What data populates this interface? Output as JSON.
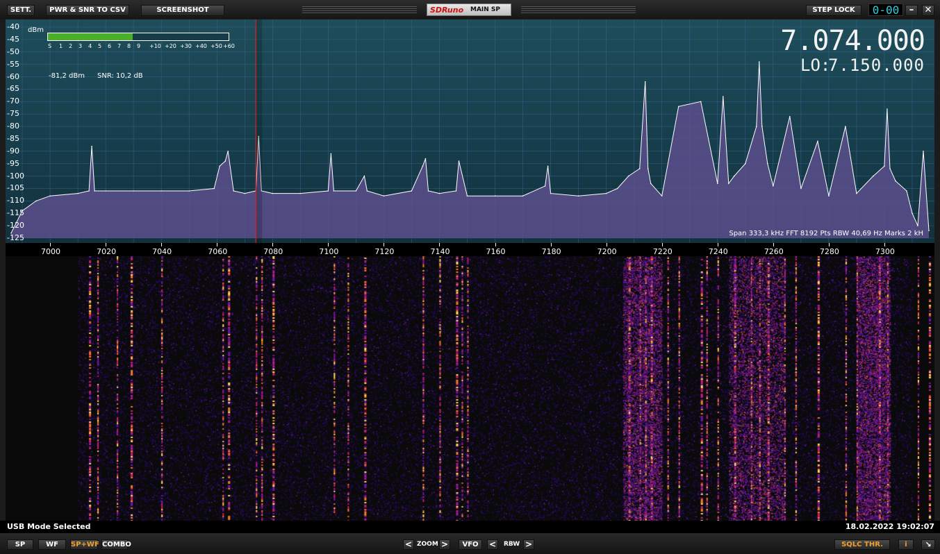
{
  "toolbar": {
    "settings_label": "SETT.",
    "csv_label": "PWR & SNR TO CSV",
    "screenshot_label": "SCREENSHOT",
    "logo_text": "SDRuno",
    "panel_title": "MAIN SP",
    "step_lock_label": "STEP LOCK",
    "step_display": "0-00",
    "minimize_icon": "minimize-icon",
    "close_icon": "close-icon"
  },
  "spectrum": {
    "dbm_unit": "dBm",
    "y_labels": [
      "-40",
      "-45",
      "-50",
      "-55",
      "-60",
      "-65",
      "-70",
      "-75",
      "-80",
      "-85",
      "-90",
      "-95",
      "-100",
      "-105",
      "-110",
      "-115",
      "-120",
      "-125"
    ],
    "x_labels": [
      "7000",
      "7020",
      "7040",
      "7060",
      "7080",
      "7100",
      "7120",
      "7140",
      "7160",
      "7180",
      "7200",
      "7220",
      "7240",
      "7260",
      "7280",
      "7300"
    ],
    "s_scale": [
      "S",
      "1",
      "2",
      "3",
      "4",
      "5",
      "6",
      "7",
      "8",
      "9",
      "+10",
      "+20",
      "+30",
      "+40",
      "+50",
      "+60"
    ],
    "meter_level_fraction": 0.47,
    "signal_level": "-81,2 dBm",
    "snr": "SNR: 10,2 dB",
    "vfo_frequency": "7.074.000",
    "lo_label": "LO:",
    "lo_frequency": "7.150.000",
    "info_line": "Span 333,3 kHz   FFT 8192 Pts   RBW 40,69 Hz   Marks 2 kH",
    "colors": {
      "background": "#1f4d5a",
      "trace_fill": "#5a4f8c",
      "trace_line": "#ffffff",
      "vfo_marker": "#e02020",
      "meter": "#4caf2a"
    }
  },
  "chart_data": {
    "type": "area",
    "title": "",
    "xlabel": "",
    "ylabel": "dBm",
    "xlim": [
      6984,
      7318
    ],
    "ylim": [
      -125,
      -40
    ],
    "grid": true,
    "x": [
      6986,
      6990,
      6995,
      7000,
      7010,
      7014,
      7015,
      7016,
      7020,
      7030,
      7040,
      7050,
      7059,
      7061,
      7063,
      7064,
      7066,
      7070,
      7074,
      7075,
      7076,
      7080,
      7090,
      7100,
      7101,
      7102,
      7110,
      7113,
      7114,
      7120,
      7130,
      7134,
      7135,
      7136,
      7140,
      7146,
      7147,
      7150,
      7160,
      7170,
      7178,
      7179,
      7180,
      7190,
      7200,
      7204,
      7208,
      7212,
      7214,
      7215,
      7216,
      7220,
      7226,
      7234,
      7240,
      7242,
      7244,
      7246,
      7250,
      7254,
      7255,
      7256,
      7258,
      7260,
      7266,
      7270,
      7276,
      7280,
      7286,
      7290,
      7296,
      7300,
      7301,
      7302,
      7304,
      7308,
      7310,
      7312,
      7314,
      7316
    ],
    "y": [
      -123,
      -114,
      -110,
      -108,
      -107,
      -106,
      -88,
      -106,
      -106,
      -106,
      -106,
      -106,
      -105,
      -96,
      -94,
      -90,
      -106,
      -107,
      -106,
      -84,
      -106,
      -107,
      -107,
      -106,
      -91,
      -106,
      -106,
      -100,
      -106,
      -108,
      -106,
      -96,
      -93,
      -106,
      -107,
      -106,
      -94,
      -108,
      -108,
      -108,
      -104,
      -96,
      -107,
      -108,
      -107,
      -105,
      -100,
      -97,
      -62,
      -97,
      -103,
      -108,
      -72,
      -70,
      -103,
      -68,
      -103,
      -100,
      -95,
      -80,
      -54,
      -80,
      -95,
      -104,
      -76,
      -105,
      -86,
      -108,
      -80,
      -107,
      -100,
      -96,
      -73,
      -97,
      -102,
      -106,
      -115,
      -120,
      -90,
      -122
    ],
    "series": [
      {
        "values": [
          -123,
          -114,
          -110,
          -108,
          -107,
          -106,
          -88,
          -106,
          -106,
          -106,
          -106,
          -106,
          -105,
          -96,
          -94,
          -90,
          -106,
          -107,
          -106,
          -84,
          -106,
          -107,
          -107,
          -106,
          -91,
          -106,
          -106,
          -100,
          -106,
          -108,
          -106,
          -96,
          -93,
          -106,
          -107,
          -106,
          -94,
          -108,
          -108,
          -108,
          -104,
          -96,
          -107,
          -108,
          -107,
          -105,
          -100,
          -97,
          -62,
          -97,
          -103,
          -108,
          -72,
          -70,
          -103,
          -68,
          -103,
          -100,
          -95,
          -80,
          -54,
          -80,
          -95,
          -104,
          -76,
          -105,
          -86,
          -108,
          -80,
          -107,
          -100,
          -96,
          -73,
          -97,
          -102,
          -106,
          -115,
          -120,
          -90,
          -122
        ]
      }
    ],
    "vfo_marker_khz": 7074
  },
  "waterfall": {
    "bright_lines_khz": [
      7014,
      7017,
      7024,
      7029,
      7040,
      7062,
      7064,
      7074,
      7076,
      7080,
      7102,
      7107,
      7113,
      7134,
      7140,
      7146,
      7148,
      7150,
      7208,
      7212,
      7214,
      7216,
      7222,
      7226,
      7234,
      7236,
      7240,
      7246,
      7252,
      7255,
      7258,
      7264,
      7268,
      7276,
      7286,
      7290,
      7298,
      7301,
      7312,
      7316
    ],
    "palette": [
      "#0a0a0a",
      "#2a0a6a",
      "#6a1aa8",
      "#c8206a",
      "#f08020",
      "#ffe060"
    ]
  },
  "status": {
    "mode_text": "USB Mode Selected",
    "timestamp": "18.02.2022 19:02:07"
  },
  "bottom": {
    "sp_label": "SP",
    "wf_label": "WF",
    "spwf_label": "SP+WF",
    "combo_label": "COMBO",
    "zoom_label": "ZOOM",
    "vfo_label": "VFO",
    "rbw_label": "RBW",
    "left_arrow": "<",
    "right_arrow": ">",
    "sqlc_label": "SQLC THR.",
    "info_label": "i",
    "resize_icon": "resize-icon"
  }
}
